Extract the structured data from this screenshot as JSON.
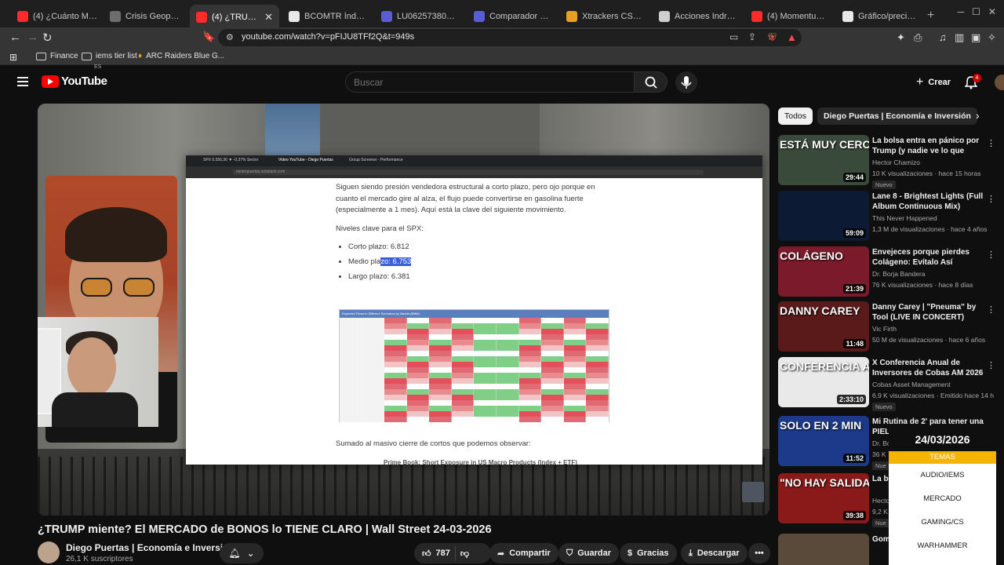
{
  "browser": {
    "tabs": [
      {
        "title": "(4) ¿Cuánto Músculo E",
        "color": "#ff2a2a"
      },
      {
        "title": "Crisis Geopolítica 2026",
        "color": "#6d6d6d"
      },
      {
        "title": "(4) ¿TRUMP mi",
        "color": "#ff2a2a",
        "active": true
      },
      {
        "title": "BCOMTR Índice de gr",
        "color": "#e8e8e8"
      },
      {
        "title": "LU0625738058 - Pictet",
        "color": "#5b5bd6"
      },
      {
        "title": "Comparador de fondo",
        "color": "#5b5bd6"
      },
      {
        "title": "Xtrackers CSI 300 Swa",
        "color": "#e8a020"
      },
      {
        "title": "Acciones Indra hoy en",
        "color": "#cfcfcf"
      },
      {
        "title": "(4) Momentum Financ",
        "color": "#ff2a2a"
      },
      {
        "title": "Gráfico/precio accione",
        "color": "#e8e8e8"
      }
    ],
    "url": "youtube.com/watch?v=pFIJU8TFf2Q&t=949s",
    "bookmarks": [
      "Finance",
      "iems tier list",
      "ARC Raiders Blue G..."
    ]
  },
  "youtube": {
    "logo": "YouTube",
    "region": "ES",
    "search_placeholder": "Buscar",
    "create_label": "Crear",
    "notif_count": "4"
  },
  "video": {
    "title": "¿TRUMP miente? El MERCADO de BONOS lo TIENE CLARO | Wall Street 24-03-2026",
    "channel": "Diego Puertas | Economía e Inversión",
    "subscribers": "26,1 K suscriptores",
    "likes": "787",
    "share": "Compartir",
    "save": "Guardar",
    "thanks": "Gracias",
    "download": "Descargar"
  },
  "doc": {
    "para1": "Siguen siendo presión vendedora estructural a corto plazo, pero ojo porque en cuanto el mercado gire al alza, el flujo puede convertirse en gasolina fuerte (especialmente a 1 mes). Aquí está la clave del siguiente movimiento.",
    "levels_title": "Niveles clave para el SPX:",
    "level1": "Corto plazo: 6.812",
    "level2_pre": "Medio pla",
    "level2_hl": "zo: 6.753",
    "level3": "Largo plazo: 6.381",
    "heat_title": "Expected Flows in Different Scenarios by Market ($MM)",
    "foot1": "Sumado al masivo cierre de cortos que podemos observar:",
    "foot2": "Prime Book: Short Exposure in US Macro Products (Index + ETF)",
    "url": "misterpuertas.substack.com",
    "tab1": "SPX 6.556,36 ▼ -0,37% Sector",
    "tab2": "Video YouTube - Diego Puertas",
    "tab3": "Group Screener - Performance"
  },
  "sidebar": {
    "chips": [
      "Todos",
      "Diego Puertas | Economía e Inversión"
    ],
    "items": [
      {
        "title": "La bolsa entra en pánico por Trump (y nadie ve lo que viene...",
        "channel": "Hector Chamizo",
        "meta": "10 K visualizaciones · hace 15 horas",
        "badge": "Nuevo",
        "duration": "29:44",
        "thumbtext": "ESTÁ MUY CERCA",
        "bg": "#3a4a3a"
      },
      {
        "title": "Lane 8 - Brightest Lights (Full Album Continuous Mix)",
        "channel": "This Never Happened",
        "meta": "1,3 M de visualizaciones · hace 4 años",
        "badge": "",
        "duration": "59:09",
        "thumbtext": "",
        "bg": "#0d1a33"
      },
      {
        "title": "Envejeces porque pierdes Colágeno: Evítalo Así",
        "channel": "Dr. Borja Bandera",
        "meta": "76 K visualizaciones · hace 8 días",
        "badge": "",
        "duration": "21:39",
        "thumbtext": "COLÁGENO",
        "bg": "#7a1a2a"
      },
      {
        "title": "Danny Carey | \"Pneuma\" by Tool (LIVE IN CONCERT)",
        "channel": "Vic Firth",
        "meta": "50 M de visualizaciones · hace 6 años",
        "badge": "",
        "duration": "11:48",
        "thumbtext": "DANNY CAREY",
        "bg": "#5a1a1a"
      },
      {
        "title": "X Conferencia Anual de Inversores de Cobas AM 2026",
        "channel": "Cobas Asset Management",
        "meta": "6,9 K visualizaciones · Emitido hace 14 h",
        "badge": "Nuevo",
        "duration": "2:33:10",
        "thumbtext": "CONFERENCIA ANUAL 2026 INVERSORES",
        "bg": "#e9e9e9"
      },
      {
        "title": "Mi Rutina de 2' para tener una PIEL",
        "channel": "Dr. Bo",
        "meta": "36 K",
        "badge": "Nue",
        "duration": "11:52",
        "thumbtext": "SOLO EN 2 MIN",
        "bg": "#1d3a8a"
      },
      {
        "title": "La be peligr",
        "channel": "Hecto",
        "meta": "9,2 K",
        "badge": "Nue",
        "duration": "39:38",
        "thumbtext": "\"NO HAY SALIDA\"",
        "bg": "#8a1a1a"
      },
      {
        "title": "Gom",
        "channel": "",
        "meta": "",
        "badge": "",
        "duration": "",
        "thumbtext": "",
        "bg": "#5a4a3a"
      }
    ]
  },
  "overlay": {
    "date": "24/03/2026",
    "items": [
      "TEMAS",
      "AUDIO/IEMS",
      "MERCADO",
      "GAMING/CS",
      "WARHAMMER"
    ],
    "accent": "#f5b400"
  }
}
